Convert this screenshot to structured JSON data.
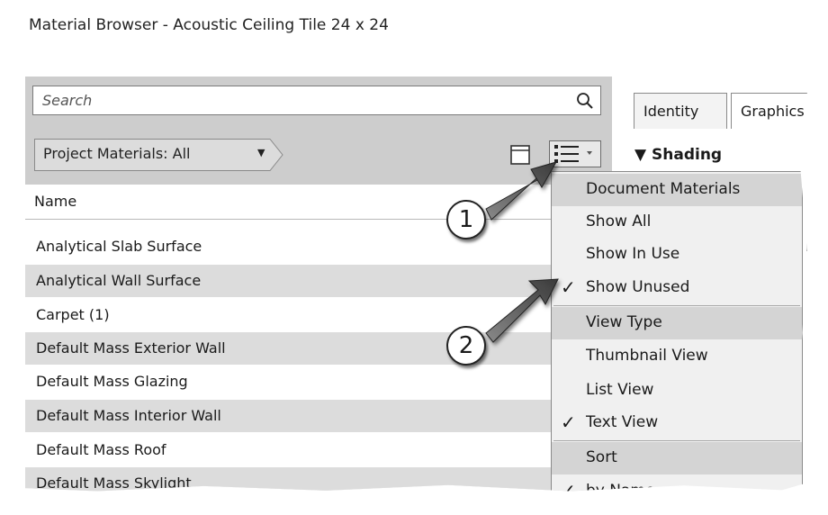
{
  "window": {
    "title": "Material Browser - Acoustic Ceiling Tile 24 x 24"
  },
  "search": {
    "placeholder": "Search",
    "icon": "search-icon"
  },
  "filter": {
    "label": "Project Materials: All"
  },
  "list": {
    "header": "Name",
    "rows": [
      "Analytical Slab Surface",
      "Analytical Wall Surface",
      "Carpet (1)",
      "Default Mass Exterior Wall",
      "Default Mass Glazing",
      "Default Mass Interior Wall",
      "Default Mass Roof",
      "Default Mass Skylight"
    ]
  },
  "tabs": [
    "Identity",
    "Graphics"
  ],
  "section": {
    "label": "Shading"
  },
  "menu": {
    "items": [
      {
        "label": "Document Materials",
        "type": "header",
        "checked": false
      },
      {
        "label": "Show All",
        "type": "item",
        "checked": false
      },
      {
        "label": "Show In Use",
        "type": "item",
        "checked": false
      },
      {
        "label": "Show Unused",
        "type": "item",
        "checked": true
      },
      {
        "label": "View Type",
        "type": "header",
        "checked": false
      },
      {
        "label": "Thumbnail View",
        "type": "item",
        "checked": false
      },
      {
        "label": "List View",
        "type": "item",
        "checked": false
      },
      {
        "label": "Text View",
        "type": "item",
        "checked": true
      },
      {
        "label": "Sort",
        "type": "header",
        "checked": false
      },
      {
        "label": "by Name",
        "type": "item",
        "checked": true
      }
    ]
  },
  "callouts": [
    "1",
    "2"
  ],
  "colors": {
    "pane": "#cdcdcd",
    "row_alt": "#dcdcdc",
    "menu_bg": "#f0f0f0",
    "menu_header": "#d4d4d4"
  }
}
